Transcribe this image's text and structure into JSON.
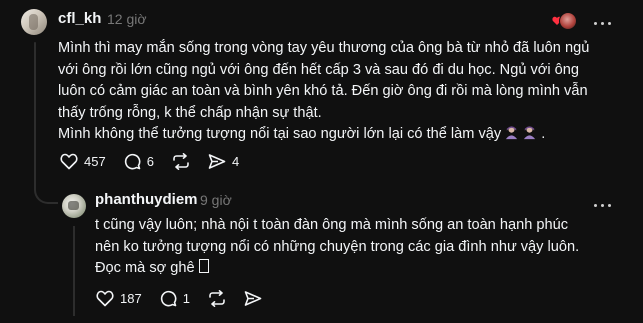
{
  "post": {
    "username": "cfl_kh",
    "time": "12 giờ",
    "lines": [
      "Mình thì may mắn sống trong vòng tay yêu thương của ông bà từ nhỏ đã luôn ngủ",
      "với ông rồi lớn cũng ngủ với ông đến hết cấp 3 và sau đó đi du học. Ngủ với ông",
      "luôn có cảm giác an toàn và bình yên khó tả. Đến giờ ông đi rồi mà lòng mình vẫn",
      "thấy trống rỗng, k thể chấp nhận sự thật.",
      "Mình không thể tưởng tượng nổi tại sao người lớn lại có thể làm vậy",
      "."
    ],
    "likes": "457",
    "comments": "6",
    "shares": "4",
    "icons": [
      "heart-icon",
      "comment-icon",
      "repost-icon",
      "share-icon",
      "more-icon"
    ]
  },
  "reply": {
    "username": "phanthuydiem",
    "time": "9 giờ",
    "lines": [
      "t cũng vậy luôn; nhà nội t toàn đàn ông mà mình sống an toàn hạnh phúc",
      "nên ko tưởng tượng nổi có những chuyện trong các gia đình như vậy luôn.",
      "Đọc mà sợ ghê"
    ],
    "likes": "187",
    "comments": "1"
  },
  "colors": {
    "background": "#101010",
    "text": "#f3f5f7",
    "muted": "#777777",
    "heart": "#ff3040"
  }
}
